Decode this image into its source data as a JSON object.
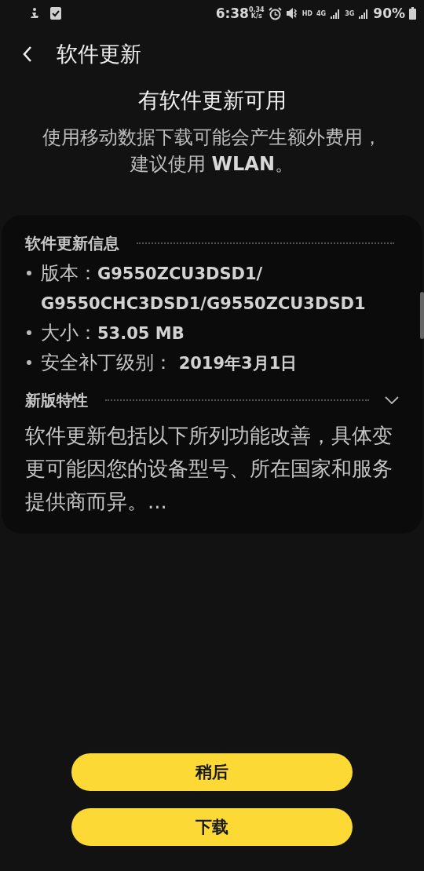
{
  "status_bar": {
    "time": "6:38",
    "speed": [
      "0.34",
      "K/s"
    ],
    "hd": "HD",
    "network_1": "4G",
    "network_2": "3G",
    "battery": "90%"
  },
  "header": {
    "title": "软件更新"
  },
  "notice": {
    "title": "有软件更新可用",
    "message": "使用移动数据下载可能会产生额外费用，建议使用 **WLAN**。"
  },
  "info": {
    "title": "软件更新信息",
    "items": [
      {
        "text": "版本：**G9550ZCU3DSD1/\nG9550CHC3DSD1/G9550ZCU3DSD1**"
      },
      {
        "text": "大小：**53.05 MB**"
      },
      {
        "text": "安全补丁级别： **2019年3月1日**"
      }
    ]
  },
  "features": {
    "title": "新版特性",
    "expanded": false,
    "text": "软件更新包括以下所列功能改善，具体变更可能因您的设备型号、所在国家和服务提供商而异。..."
  },
  "buttons": [
    {
      "label": "稍后"
    },
    {
      "label": "下载"
    }
  ]
}
